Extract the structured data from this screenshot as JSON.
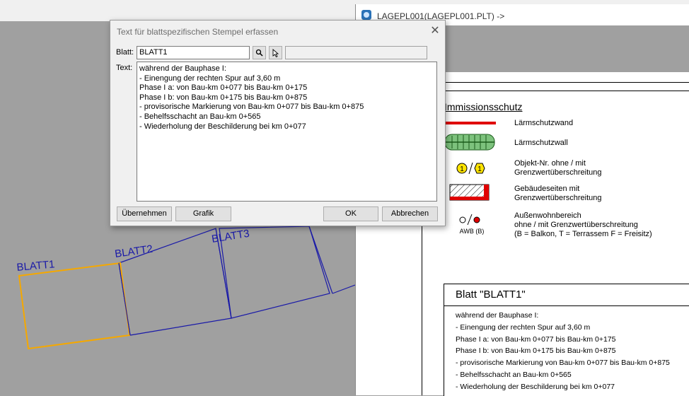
{
  "background_window": {
    "title": "LAGEPL001(LAGEPL001.PLT) ->"
  },
  "dialog": {
    "title": "Text für blattspezifischen Stempel erfassen",
    "close_glyph": "✕",
    "blatt_label": "Blatt:",
    "blatt_value": "BLATT1",
    "text_label": "Text:",
    "text_value": "während der Bauphase I:\n- Einengung der rechten Spur auf 3,60 m\nPhase I a: von Bau-km 0+077 bis Bau-km 0+175\nPhase I b: von Bau-km 0+175 bis Bau-km 0+875\n- provisorische Markierung von Bau-km 0+077 bis Bau-km 0+875\n- Behelfsschacht an Bau-km 0+565\n- Wiederholung der Beschilderung bei km 0+077",
    "buttons": {
      "uebernehmen": "Übernehmen",
      "grafik": "Grafik",
      "ok": "OK",
      "abbrechen": "Abbrechen"
    }
  },
  "map": {
    "sheets": [
      "BLATT1",
      "BLATT2",
      "BLATT3"
    ],
    "colors": {
      "selected": "#f5a800",
      "normal": "#1a1aa8"
    }
  },
  "legend": {
    "heading": "Immissionsschutz",
    "items": [
      {
        "label": "Lärmschutzwand"
      },
      {
        "label": "Lärmschutzwall"
      },
      {
        "label": "Objekt-Nr. ohne / mit\nGrenzwertüberschreitung",
        "symbol_text": "1"
      },
      {
        "label": "Gebäudeseiten mit\nGrenzwertüberschreitung"
      },
      {
        "label": "Außenwohnbereich\nohne / mit Grenzwertüberschreitung\n(B = Balkon, T = Terrassem F = Freisitz)",
        "symbol_text": "AWB (B)"
      }
    ]
  },
  "sheet_stamp": {
    "title": "Blatt \"BLATT1\"",
    "body": "während der Bauphase I:\n- Einengung der rechten Spur auf 3,60 m\nPhase I a: von Bau-km 0+077 bis Bau-km 0+175\nPhase I b: von Bau-km 0+175 bis Bau-km 0+875\n- provisorische Markierung von Bau-km 0+077 bis Bau-km 0+875\n- Behelfsschacht an Bau-km 0+565\n- Wiederholung der Beschilderung bei km 0+077"
  }
}
